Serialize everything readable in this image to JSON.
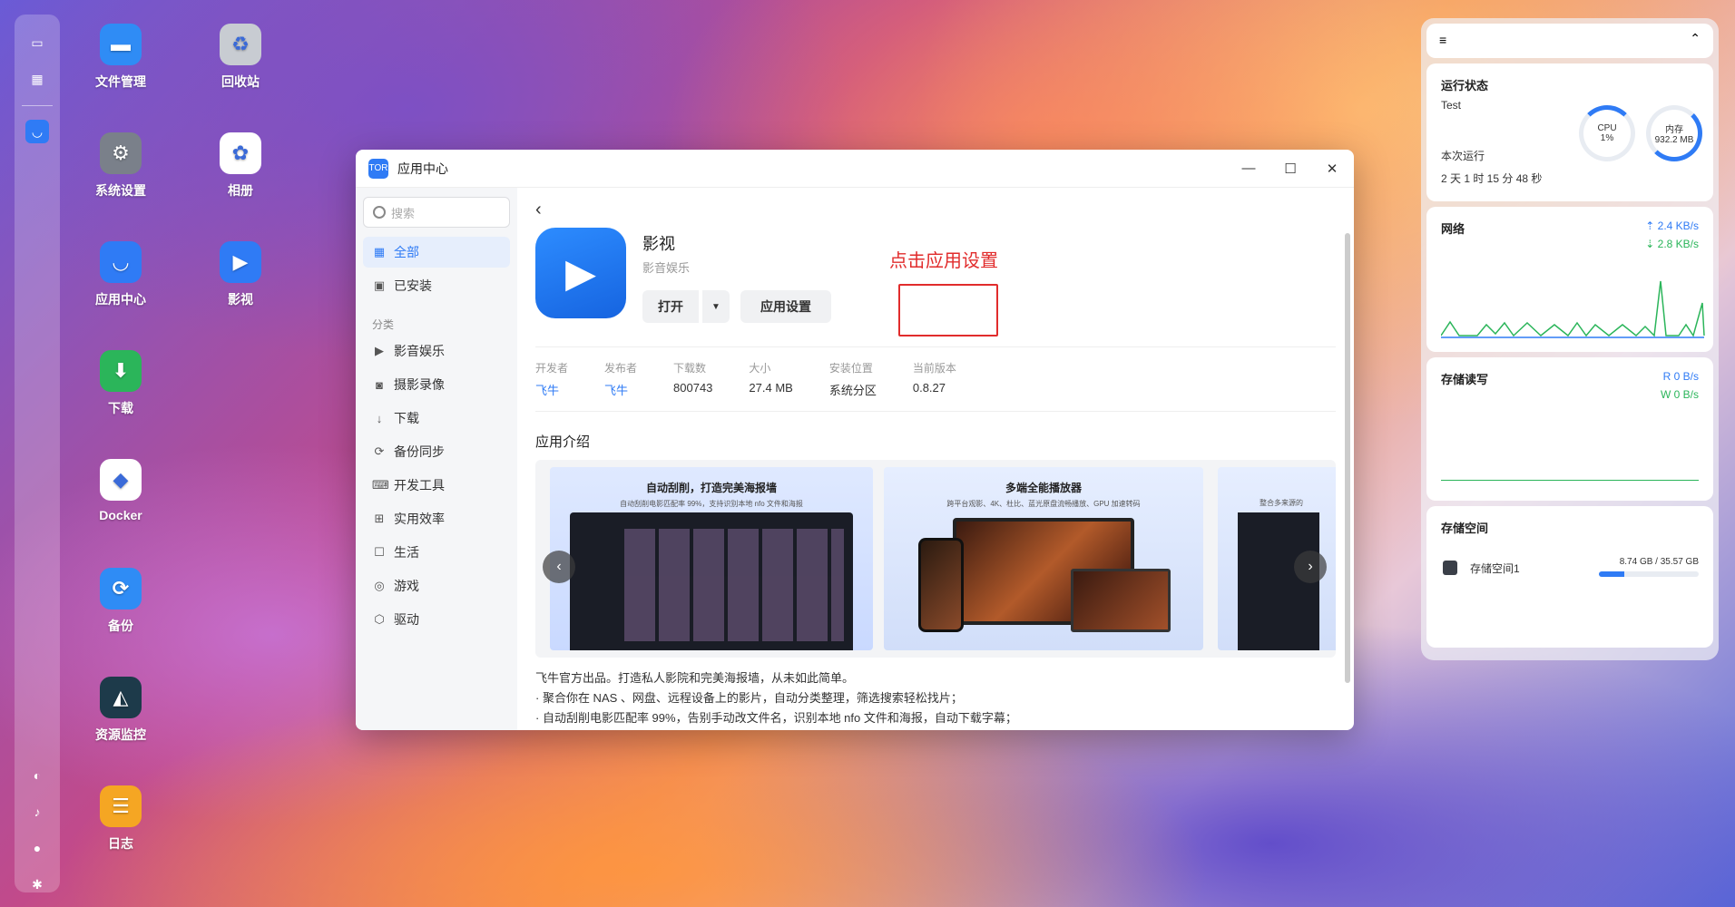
{
  "desktop_icons": [
    {
      "label": "文件管理",
      "icon": "folder-icon",
      "color": "#2f8cf5"
    },
    {
      "label": "回收站",
      "icon": "recycle-icon",
      "color": "#c8ccd2"
    },
    {
      "label": "系统设置",
      "icon": "gear-icon",
      "color": "#7a808a"
    },
    {
      "label": "相册",
      "icon": "photos-icon",
      "color": "#ffffff"
    },
    {
      "label": "应用中心",
      "icon": "store-icon",
      "color": "#2f7bf5"
    },
    {
      "label": "影视",
      "icon": "video-icon",
      "color": "#2f7bf5"
    },
    {
      "label": "下载",
      "icon": "download-icon",
      "color": "#2bb55a"
    },
    {
      "label": "Docker",
      "icon": "docker-icon",
      "color": "#ffffff"
    },
    {
      "label": "备份",
      "icon": "backup-icon",
      "color": "#2f8cf5"
    },
    {
      "label": "资源监控",
      "icon": "monitor-icon",
      "color": "#1d3a4a"
    },
    {
      "label": "日志",
      "icon": "log-icon",
      "color": "#f5a623"
    }
  ],
  "window": {
    "title": "应用中心",
    "logo_text": "STORE"
  },
  "sidebar": {
    "search_placeholder": "搜索",
    "main_items": [
      {
        "label": "全部",
        "icon": "grid-icon",
        "glyph": "▦",
        "active": true
      },
      {
        "label": "已安装",
        "icon": "installed-icon",
        "glyph": "▣",
        "active": false
      }
    ],
    "section_label": "分类",
    "categories": [
      {
        "label": "影音娱乐",
        "icon": "video-camera-icon",
        "glyph": "▶"
      },
      {
        "label": "摄影录像",
        "icon": "camera-icon",
        "glyph": "◙"
      },
      {
        "label": "下载",
        "icon": "download-icon",
        "glyph": "↓"
      },
      {
        "label": "备份同步",
        "icon": "sync-icon",
        "glyph": "⟳"
      },
      {
        "label": "开发工具",
        "icon": "code-icon",
        "glyph": "⌨"
      },
      {
        "label": "实用效率",
        "icon": "briefcase-icon",
        "glyph": "⊞"
      },
      {
        "label": "生活",
        "icon": "life-icon",
        "glyph": "☐"
      },
      {
        "label": "游戏",
        "icon": "gamepad-icon",
        "glyph": "◎"
      },
      {
        "label": "驱动",
        "icon": "cube-icon",
        "glyph": "⬡"
      }
    ]
  },
  "app": {
    "name": "影视",
    "category": "影音娱乐",
    "open_label": "打开",
    "settings_label": "应用设置",
    "annotation": "点击应用设置",
    "meta": [
      {
        "key": "开发者",
        "value": "飞牛",
        "link": true
      },
      {
        "key": "发布者",
        "value": "飞牛",
        "link": true
      },
      {
        "key": "下载数",
        "value": "800743",
        "link": false
      },
      {
        "key": "大小",
        "value": "27.4 MB",
        "link": false
      },
      {
        "key": "安装位置",
        "value": "系统分区",
        "link": false
      },
      {
        "key": "当前版本",
        "value": "0.8.27",
        "link": false
      }
    ],
    "intro_title": "应用介绍",
    "screenshots": [
      {
        "title": "自动刮削，打造完美海报墙",
        "subtitle": "自动刮削电影匹配率 99%，支持识别本地 nfo 文件和海报"
      },
      {
        "title": "多端全能播放器",
        "subtitle": "跨平台观影、4K、杜比、蓝光原盘流畅播放、GPU 加速转码"
      },
      {
        "title": "",
        "subtitle": "整合多来源的"
      }
    ],
    "description": [
      "飞牛官方出品。打造私人影院和完美海报墙，从未如此简单。",
      "· 聚合你在 NAS 、网盘、远程设备上的影片，自动分类整理，筛选搜索轻松找片；",
      "· 自动刮削电影匹配率 99%，告别手动改文件名，识别本地 nfo 文件和海报，自动下载字幕；"
    ]
  },
  "widgets": {
    "status": {
      "title": "运行状态",
      "host": "Test",
      "uptime_label": "本次运行",
      "uptime": "2 天 1 时 15 分 48 秒",
      "cpu_label": "CPU",
      "cpu_value": "1%",
      "mem_label": "内存",
      "mem_value": "932.2 MB"
    },
    "network": {
      "title": "网络",
      "up": "2.4 KB/s",
      "down": "2.8 KB/s"
    },
    "storage_io": {
      "title": "存储读写",
      "read": "R  0 B/s",
      "write": "W  0 B/s"
    },
    "storage_space": {
      "title": "存储空间",
      "volume": "存储空间1",
      "usage": "8.74 GB / 35.57 GB",
      "fraction": 0.25
    }
  },
  "colors": {
    "accent": "#2f7bf5",
    "highlight": "#e12c2c"
  }
}
